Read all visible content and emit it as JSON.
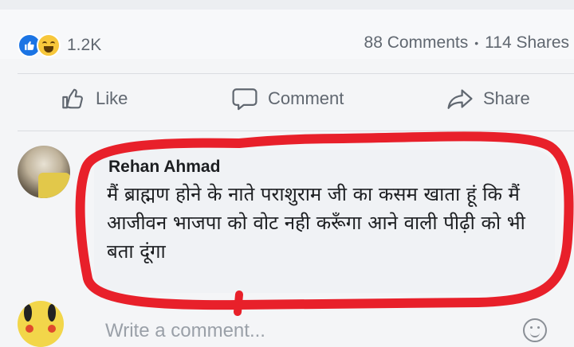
{
  "post_stats": {
    "reaction_count": "1.2K",
    "reaction_icons": [
      "like-icon",
      "haha-icon"
    ],
    "comments_count": "88 Comments",
    "separator": "•",
    "shares_count": "114 Shares"
  },
  "actions": {
    "like_label": "Like",
    "comment_label": "Comment",
    "share_label": "Share"
  },
  "comment": {
    "author": "Rehan Ahmad",
    "text": "मैं ब्राह्मण होने के नाते पराशुराम जी का कसम खाता हूं कि मैं आजीवन भाजपा को वोट नही करूँगा आने वाली पीढ़ी को भी बता दूंगा"
  },
  "composer": {
    "placeholder": "Write a comment..."
  },
  "colors": {
    "like_blue": "#1b74e4",
    "highlight_red": "#e8202a",
    "icon_gray": "#606770"
  }
}
